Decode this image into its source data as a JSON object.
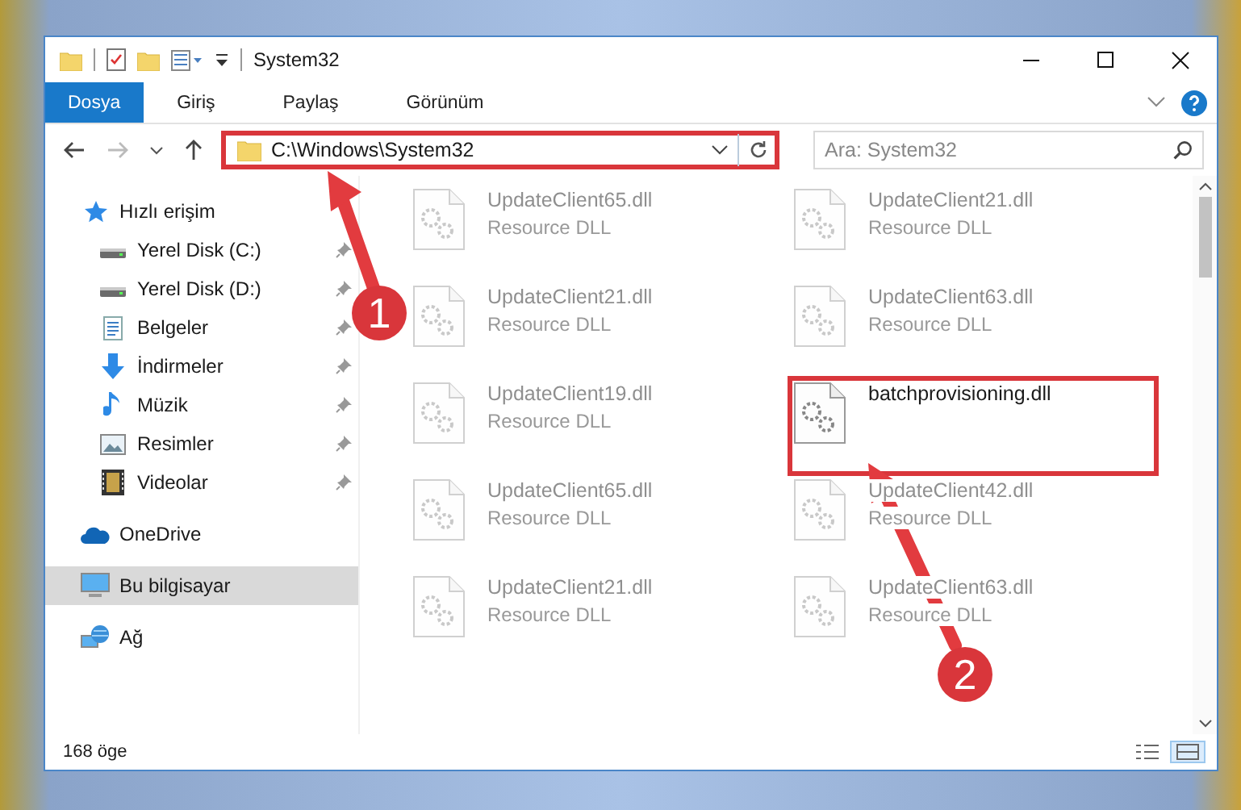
{
  "window": {
    "title": "System32"
  },
  "ribbon_tabs": [
    {
      "label": "Dosya",
      "selected": true
    },
    {
      "label": "Giriş",
      "selected": false
    },
    {
      "label": "Paylaş",
      "selected": false
    },
    {
      "label": "Görünüm",
      "selected": false
    }
  ],
  "address_bar": {
    "path": "C:\\Windows\\System32",
    "highlighted": true
  },
  "search": {
    "placeholder": "Ara: System32"
  },
  "navigation": [
    {
      "label": "Hızlı erişim",
      "kind": "star",
      "selected": false,
      "children": [
        {
          "label": "Yerel Disk (C:)",
          "kind": "drive",
          "pinned": true,
          "selected": false
        },
        {
          "label": "Yerel Disk (D:)",
          "kind": "drive",
          "pinned": true,
          "selected": false
        },
        {
          "label": "Belgeler",
          "kind": "document",
          "pinned": true,
          "selected": false
        },
        {
          "label": "İndirmeler",
          "kind": "download",
          "pinned": true,
          "selected": false
        },
        {
          "label": "Müzik",
          "kind": "music",
          "pinned": true,
          "selected": false
        },
        {
          "label": "Resimler",
          "kind": "picture",
          "pinned": true,
          "selected": false
        },
        {
          "label": "Videolar",
          "kind": "video",
          "pinned": true,
          "selected": false
        }
      ]
    },
    {
      "label": "OneDrive",
      "kind": "cloud",
      "selected": false
    },
    {
      "label": "Bu bilgisayar",
      "kind": "computer",
      "selected": true
    },
    {
      "label": "Ağ",
      "kind": "network",
      "selected": false
    }
  ],
  "files": [
    {
      "name": "UpdateClient65.dll",
      "type": "Resource DLL",
      "faded": true,
      "highlighted": false
    },
    {
      "name": "UpdateClient21.dll",
      "type": "Resource DLL",
      "faded": true,
      "highlighted": false
    },
    {
      "name": "UpdateClient21.dll",
      "type": "Resource DLL",
      "faded": true,
      "highlighted": false
    },
    {
      "name": "UpdateClient63.dll",
      "type": "Resource DLL",
      "faded": true,
      "highlighted": false
    },
    {
      "name": "UpdateClient19.dll",
      "type": "Resource DLL",
      "faded": true,
      "highlighted": false
    },
    {
      "name": "batchprovisioning.dll",
      "faded": false,
      "highlighted": true
    },
    {
      "name": "UpdateClient65.dll",
      "type": "Resource DLL",
      "faded": true,
      "highlighted": false
    },
    {
      "name": "UpdateClient42.dll",
      "type": "Resource DLL",
      "faded": true,
      "highlighted": false
    },
    {
      "name": "UpdateClient21.dll",
      "type": "Resource DLL",
      "faded": true,
      "highlighted": false
    },
    {
      "name": "UpdateClient63.dll",
      "type": "Resource DLL",
      "faded": true,
      "highlighted": false
    }
  ],
  "status_bar": {
    "item_count": "168 öge"
  },
  "view_buttons": [
    {
      "kind": "details",
      "selected": false
    },
    {
      "kind": "large",
      "selected": true
    }
  ],
  "annotations": [
    {
      "label": "1"
    },
    {
      "label": "2"
    }
  ]
}
